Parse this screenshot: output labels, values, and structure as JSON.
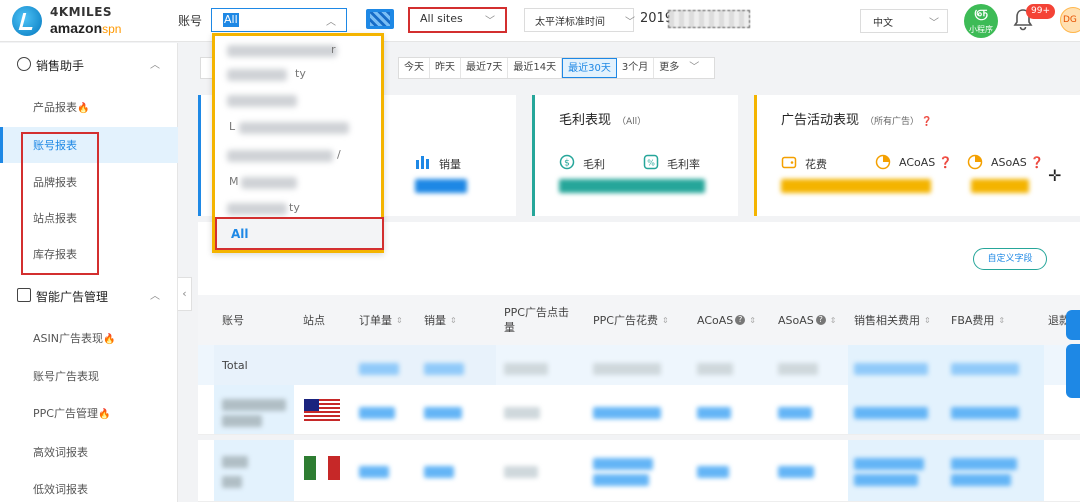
{
  "brand": {
    "line1": "4KMILES",
    "line2_a": "amazon",
    "line2_b": "spn"
  },
  "topbar": {
    "account_label": "账号",
    "account_value": "All",
    "sites_value": "All sites",
    "timezone_value": "太平洋标准时间",
    "date_prefix": "2019",
    "language_value": "中文",
    "mini_program_label": "小程序",
    "mini_program_icon": "ஞ",
    "notifications_count": "99+",
    "avatar_text": "DG"
  },
  "sidebar": {
    "group1": "销售助手",
    "group1_items": [
      {
        "label": "产品报表",
        "hot": "🔥"
      },
      {
        "label": "账号报表",
        "hot": ""
      },
      {
        "label": "品牌报表",
        "hot": ""
      },
      {
        "label": "站点报表",
        "hot": ""
      },
      {
        "label": "库存报表",
        "hot": ""
      }
    ],
    "group2": "智能广告管理",
    "group2_items": [
      {
        "label": "ASIN广告表现",
        "hot": "🔥"
      },
      {
        "label": "账号广告表现",
        "hot": ""
      },
      {
        "label": "PPC广告管理",
        "hot": "🔥"
      },
      {
        "label": "高效词报表",
        "hot": ""
      },
      {
        "label": "低效词报表",
        "hot": ""
      }
    ]
  },
  "date_tabs": [
    "今天",
    "昨天",
    "最近7天",
    "最近14天",
    "最近30天",
    "3个月",
    "更多"
  ],
  "cards": {
    "sales_metric": "销量",
    "gross": {
      "title": "毛利表现",
      "sub": "（All）",
      "m1": "毛利",
      "m2": "毛利率"
    },
    "ads": {
      "title": "广告活动表现",
      "sub": "（所有广告）",
      "m1": "花费",
      "m2": "ACoAS",
      "m3": "ASoAS"
    }
  },
  "custom_fields_button": "自定义字段",
  "table": {
    "headers": [
      "账号",
      "站点",
      "订单量",
      "销量",
      "PPC广告点击量",
      "PPC广告花费",
      "ACoAS",
      "ASoAS",
      "销售相关费用",
      "FBA费用",
      "退款"
    ],
    "total_label": "Total"
  },
  "dropdown": {
    "items": [
      "r",
      "ty",
      "",
      "L",
      "/",
      "M",
      "ty"
    ],
    "all_label": "All"
  },
  "colors": {
    "accent": "#1e88e5",
    "highlight_red": "#d32f2f",
    "highlight_yellow": "#f4b400",
    "green": "#26a69a",
    "orange": "#f4a000"
  }
}
